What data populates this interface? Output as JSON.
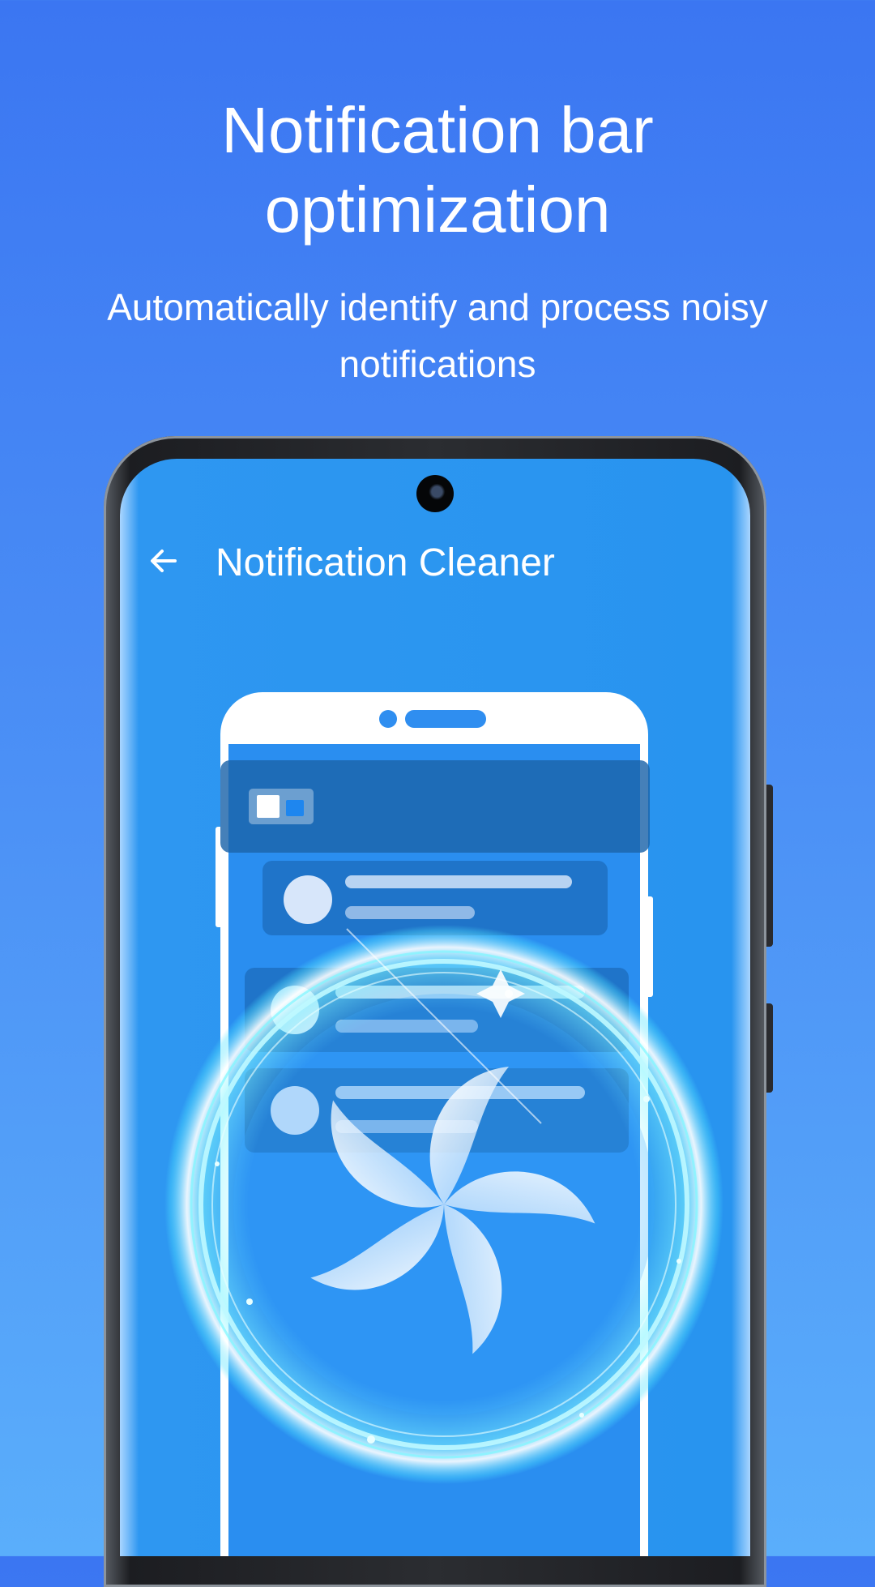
{
  "promo": {
    "headline": "Notification bar optimization",
    "subheadline": "Automatically identify and process noisy notifications"
  },
  "app": {
    "title": "Notification Cleaner",
    "back_icon": "arrow-left-icon"
  },
  "illustration": {
    "icon": "fan-cleaning-icon",
    "accent_color": "#2894ef",
    "glow_color": "#7ff6ff"
  }
}
